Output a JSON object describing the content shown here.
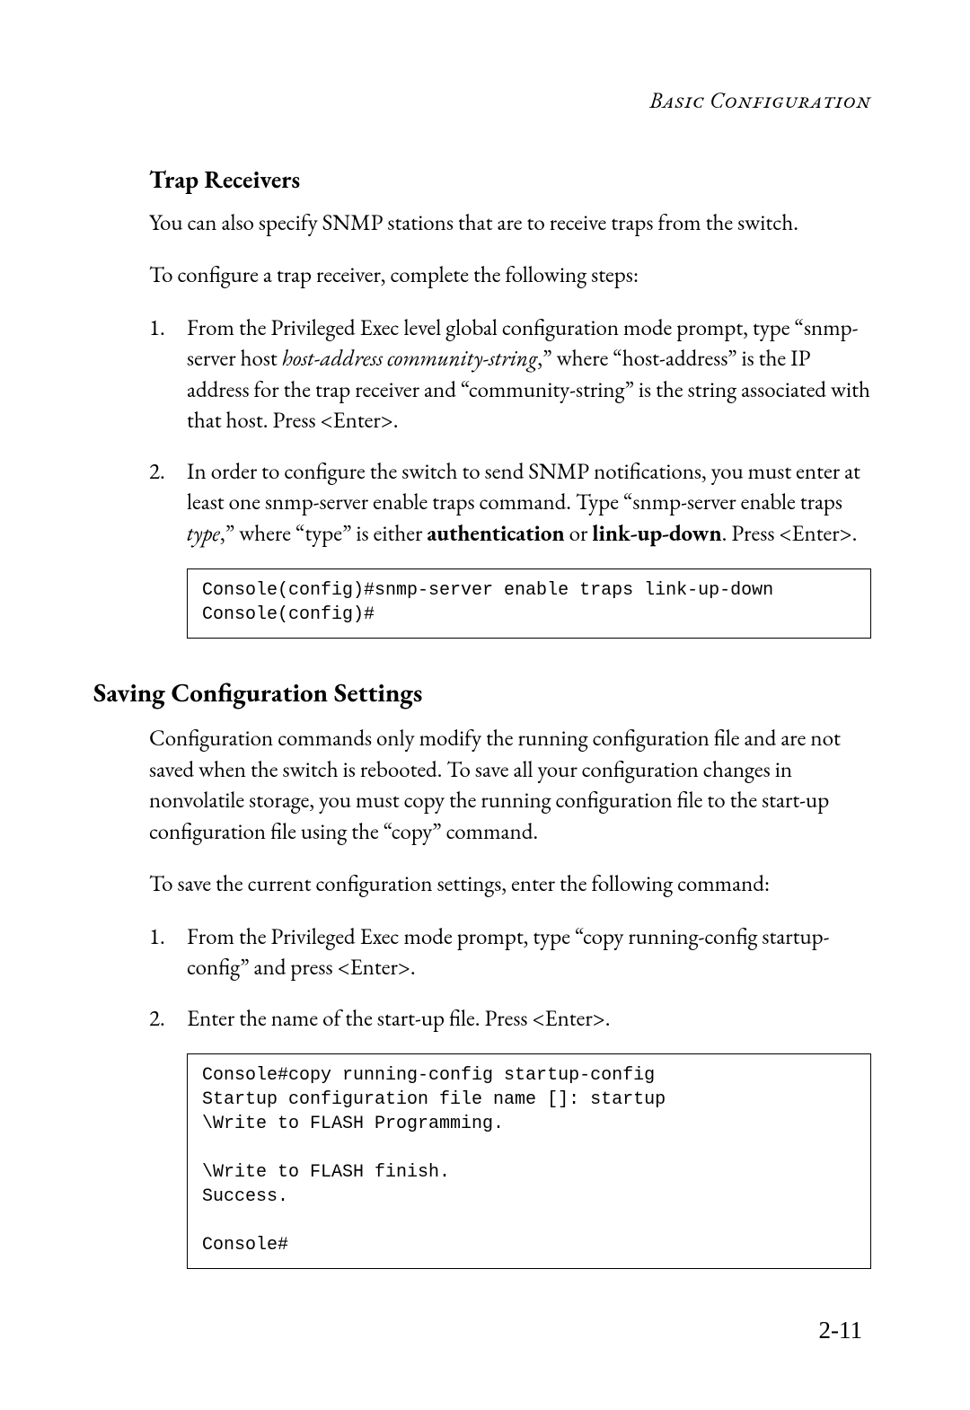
{
  "running_head": "Basic Configuration",
  "trap": {
    "heading": "Trap Receivers",
    "p1": "You can also specify SNMP stations that are to receive traps from the switch.",
    "p2": "To configure a trap receiver, complete the following steps:",
    "step1": {
      "num": "1.",
      "t1": "From the Privileged Exec level global configuration mode prompt, type “snmp-server host ",
      "cmd_italic": "host-address community-string",
      "t2": ",” where “host-address” is the IP address for the trap receiver and “community-string” is the string associated with that host. Press <Enter>."
    },
    "step2": {
      "num": "2.",
      "t1": "In order to configure the switch to send SNMP notifications, you must enter at least one snmp-server enable traps command. Type “snmp-server enable traps ",
      "cmd_italic": "type",
      "t2": ",” where “type” is either ",
      "b1": "authentication",
      "t3": " or ",
      "b2": "link-up-down",
      "t4": ". Press <Enter>."
    },
    "code": "Console(config)#snmp-server enable traps link-up-down\nConsole(config)#"
  },
  "save": {
    "heading": "Saving Configuration Settings",
    "p1": "Configuration commands only modify the running configuration file and are not saved when the switch is rebooted. To save all your configuration changes in nonvolatile storage, you must copy the running configuration file to the start-up configuration file using the “copy” command.",
    "p2": "To save the current configuration settings, enter the following command:",
    "step1": {
      "num": "1.",
      "text": "From the Privileged Exec mode prompt, type “copy running-config startup-config” and press <Enter>."
    },
    "step2": {
      "num": "2.",
      "text": "Enter the name of the start-up file. Press <Enter>."
    },
    "code": "Console#copy running-config startup-config\nStartup configuration file name []: startup\n\\Write to FLASH Programming.\n\n\\Write to FLASH finish.\nSuccess.\n\nConsole#"
  },
  "page_number": "2-11"
}
